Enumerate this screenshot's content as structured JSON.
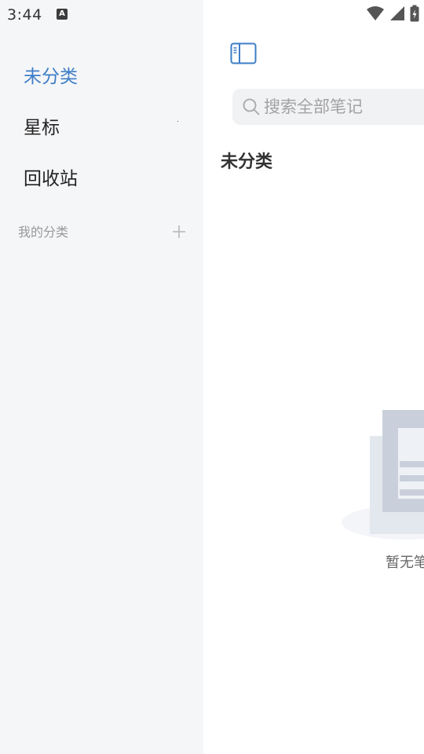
{
  "status_bar": {
    "time": "3:44",
    "notification_letter": "A"
  },
  "sidebar": {
    "items": [
      {
        "label": "未分类",
        "active": true
      },
      {
        "label": "星标",
        "active": false
      },
      {
        "label": "回收站",
        "active": false
      }
    ],
    "section_title": "我的分类",
    "add_icon": "plus-icon"
  },
  "main": {
    "search": {
      "placeholder": "搜索全部笔记"
    },
    "list_title": "未分类",
    "empty_state": {
      "text": "暂无笔"
    }
  },
  "colors": {
    "accent": "#3e7dc7",
    "sidebar_bg": "#f5f6f8",
    "search_bg": "#f1f2f4"
  }
}
